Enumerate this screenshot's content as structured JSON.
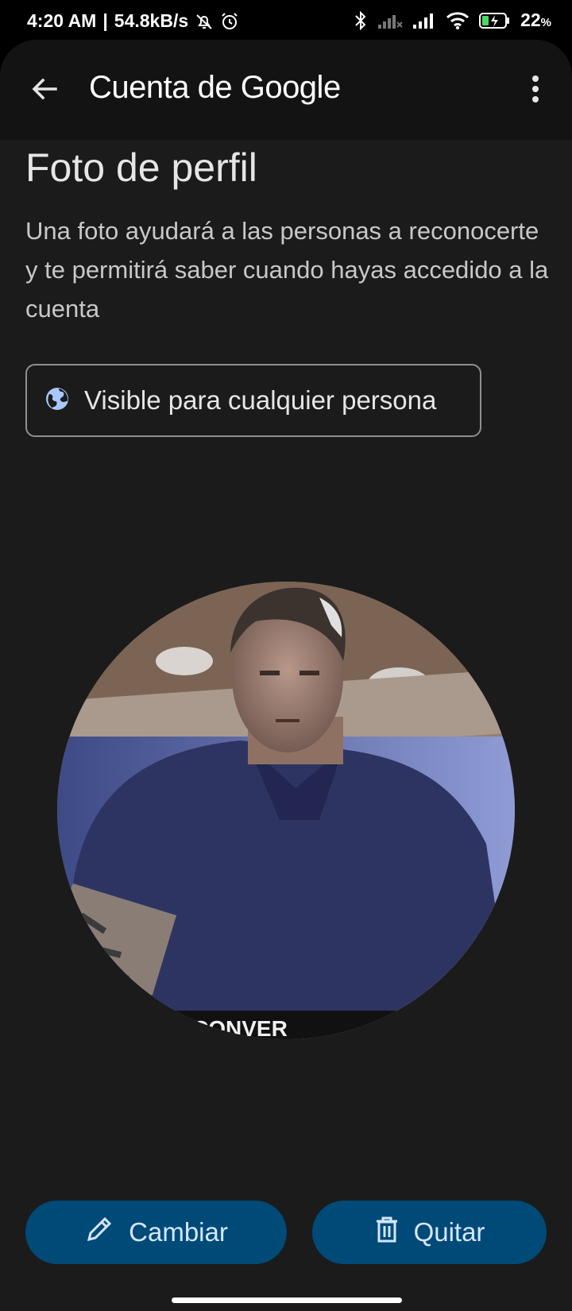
{
  "status_bar": {
    "time": "4:20 AM",
    "separator": "|",
    "speed": "54.8kB/s",
    "battery": "22",
    "battery_unit": "%",
    "icons": [
      "muted-bell-icon",
      "alarm-icon",
      "bluetooth-icon",
      "signal-no-service-icon",
      "signal-icon",
      "wifi-icon",
      "battery-charging-icon"
    ]
  },
  "appbar": {
    "title_prefix": "Cuenta de ",
    "title_brand": "Google",
    "back_icon": "arrow-left-icon",
    "menu_icon": "more-vertical-icon"
  },
  "page": {
    "title": "Foto de perfil",
    "description": "Una foto ayudará a las personas a reconocerte y te permitirá saber cuando hayas accedido a la cuenta",
    "visibility_label": "Visible para cualquier persona",
    "visibility_icon": "globe-icon",
    "shirt_text": "CONVER"
  },
  "actions": {
    "change_label": "Cambiar",
    "change_icon": "pencil-icon",
    "remove_label": "Quitar",
    "remove_icon": "trash-icon"
  },
  "colors": {
    "background": "#1b1b1b",
    "appbar": "#131313",
    "button_bg": "#004a77",
    "button_text": "#d4e6ff",
    "globe": "#a8c7fa"
  }
}
